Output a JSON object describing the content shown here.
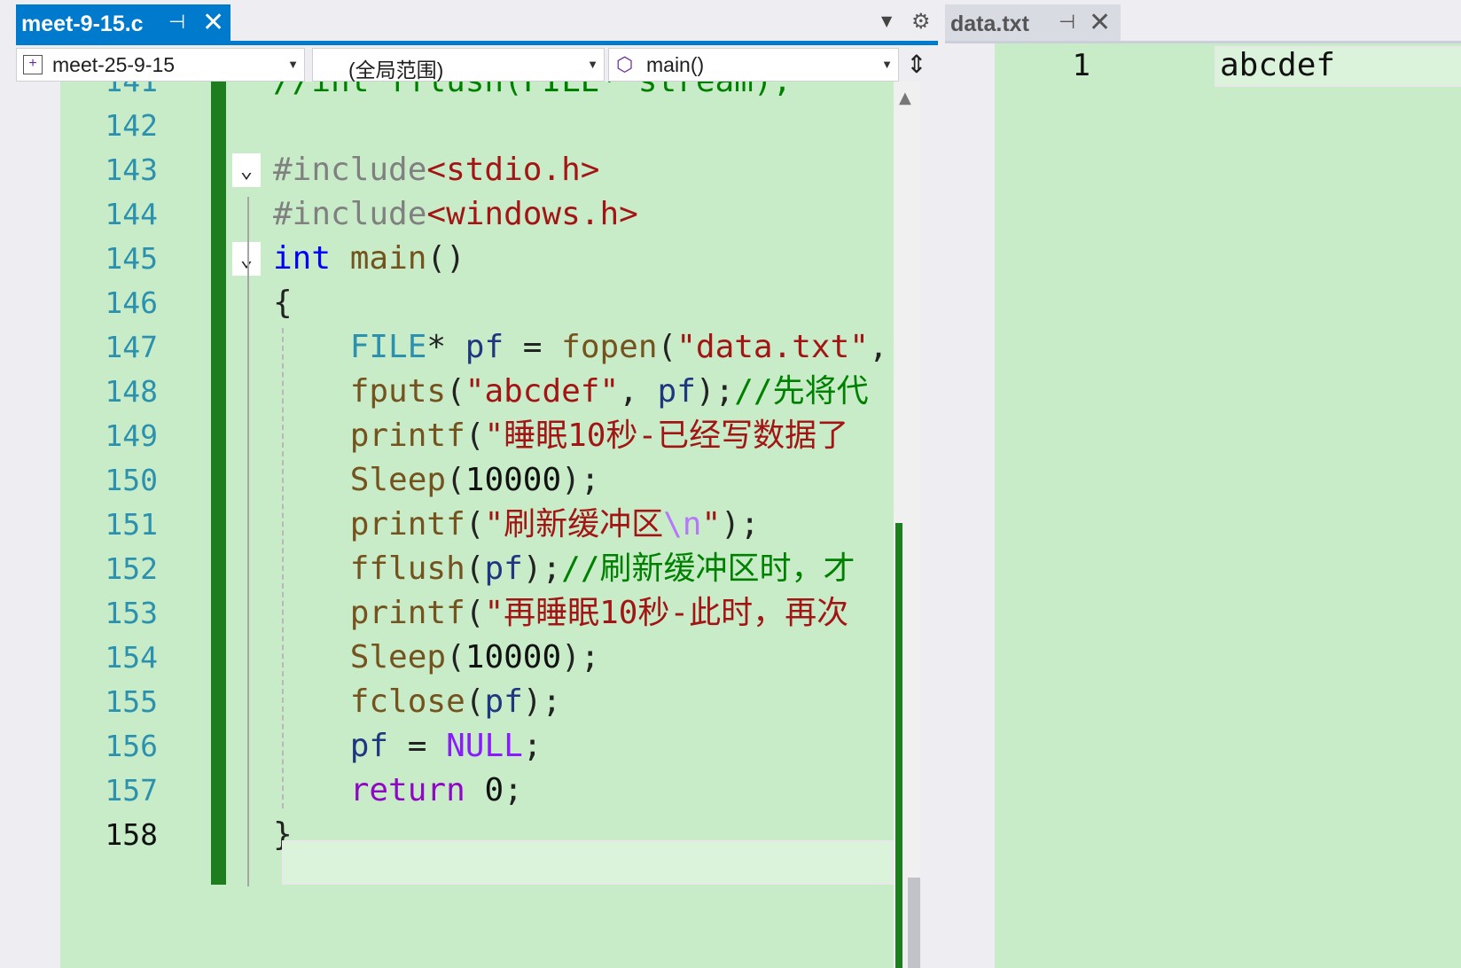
{
  "editor": {
    "tab": {
      "title": "meet-9-15.c",
      "pin_icon": "pin-icon",
      "close_icon": "close-icon"
    },
    "nav": {
      "project": "meet-25-9-15",
      "scope": "(全局范围)",
      "function": "main()"
    },
    "lines": [
      {
        "n": "141",
        "segments": [
          {
            "c": "cmt",
            "t": "//int fflush(FILE* stream);"
          }
        ]
      },
      {
        "n": "142",
        "segments": []
      },
      {
        "n": "143",
        "fold": true,
        "segments": [
          {
            "c": "pre",
            "t": "#include"
          },
          {
            "c": "str",
            "t": "<stdio.h>"
          }
        ]
      },
      {
        "n": "144",
        "segments": [
          {
            "c": "pre",
            "t": "#include"
          },
          {
            "c": "str",
            "t": "<windows.h>"
          }
        ]
      },
      {
        "n": "145",
        "fold": true,
        "segments": [
          {
            "c": "kw",
            "t": "int"
          },
          {
            "c": "",
            "t": " "
          },
          {
            "c": "fn",
            "t": "main"
          },
          {
            "c": "",
            "t": "()"
          }
        ]
      },
      {
        "n": "146",
        "segments": [
          {
            "c": "",
            "t": "{"
          }
        ]
      },
      {
        "n": "147",
        "segments": [
          {
            "c": "",
            "t": "    "
          },
          {
            "c": "typ",
            "t": "FILE"
          },
          {
            "c": "",
            "t": "* "
          },
          {
            "c": "var",
            "t": "pf"
          },
          {
            "c": "",
            "t": " = "
          },
          {
            "c": "fn",
            "t": "fopen"
          },
          {
            "c": "",
            "t": "("
          },
          {
            "c": "str",
            "t": "\"data.txt\""
          },
          {
            "c": "",
            "t": ","
          }
        ]
      },
      {
        "n": "148",
        "segments": [
          {
            "c": "",
            "t": "    "
          },
          {
            "c": "fn",
            "t": "fputs"
          },
          {
            "c": "",
            "t": "("
          },
          {
            "c": "str",
            "t": "\"abcdef\""
          },
          {
            "c": "",
            "t": ", "
          },
          {
            "c": "var",
            "t": "pf"
          },
          {
            "c": "",
            "t": ");"
          },
          {
            "c": "cmt",
            "t": "//先将代"
          }
        ]
      },
      {
        "n": "149",
        "segments": [
          {
            "c": "",
            "t": "    "
          },
          {
            "c": "fn",
            "t": "printf"
          },
          {
            "c": "",
            "t": "("
          },
          {
            "c": "str",
            "t": "\"睡眠10秒-已经写数据了"
          }
        ]
      },
      {
        "n": "150",
        "segments": [
          {
            "c": "",
            "t": "    "
          },
          {
            "c": "fn",
            "t": "Sleep"
          },
          {
            "c": "",
            "t": "("
          },
          {
            "c": "num",
            "t": "10000"
          },
          {
            "c": "",
            "t": ");"
          }
        ]
      },
      {
        "n": "151",
        "segments": [
          {
            "c": "",
            "t": "    "
          },
          {
            "c": "fn",
            "t": "printf"
          },
          {
            "c": "",
            "t": "("
          },
          {
            "c": "str",
            "t": "\"刷新缓冲区"
          },
          {
            "c": "esc",
            "t": "\\n"
          },
          {
            "c": "str",
            "t": "\""
          },
          {
            "c": "",
            "t": ");"
          }
        ]
      },
      {
        "n": "152",
        "segments": [
          {
            "c": "",
            "t": "    "
          },
          {
            "c": "fn",
            "t": "fflush"
          },
          {
            "c": "",
            "t": "("
          },
          {
            "c": "var",
            "t": "pf"
          },
          {
            "c": "",
            "t": ");"
          },
          {
            "c": "cmt",
            "t": "//刷新缓冲区时，才"
          }
        ]
      },
      {
        "n": "153",
        "segments": [
          {
            "c": "",
            "t": "    "
          },
          {
            "c": "fn",
            "t": "printf"
          },
          {
            "c": "",
            "t": "("
          },
          {
            "c": "str",
            "t": "\"再睡眠10秒-此时，再次"
          }
        ]
      },
      {
        "n": "154",
        "segments": [
          {
            "c": "",
            "t": "    "
          },
          {
            "c": "fn",
            "t": "Sleep"
          },
          {
            "c": "",
            "t": "("
          },
          {
            "c": "num",
            "t": "10000"
          },
          {
            "c": "",
            "t": ");"
          }
        ]
      },
      {
        "n": "155",
        "segments": [
          {
            "c": "",
            "t": "    "
          },
          {
            "c": "fn",
            "t": "fclose"
          },
          {
            "c": "",
            "t": "("
          },
          {
            "c": "var",
            "t": "pf"
          },
          {
            "c": "",
            "t": ");"
          }
        ]
      },
      {
        "n": "156",
        "segments": [
          {
            "c": "",
            "t": "    "
          },
          {
            "c": "var",
            "t": "pf"
          },
          {
            "c": "",
            "t": " = "
          },
          {
            "c": "mac",
            "t": "NULL"
          },
          {
            "c": "",
            "t": ";"
          }
        ]
      },
      {
        "n": "157",
        "segments": [
          {
            "c": "",
            "t": "    "
          },
          {
            "c": "kw2",
            "t": "return"
          },
          {
            "c": "",
            "t": " "
          },
          {
            "c": "num",
            "t": "0"
          },
          {
            "c": "",
            "t": ";"
          }
        ]
      },
      {
        "n": "158",
        "active": true,
        "segments": [
          {
            "c": "",
            "t": "}"
          }
        ]
      }
    ]
  },
  "data_file": {
    "tab": {
      "title": "data.txt",
      "pin_icon": "pin-icon",
      "close_icon": "close-icon"
    },
    "lines": [
      {
        "n": "1",
        "text": "abcdef"
      }
    ]
  }
}
